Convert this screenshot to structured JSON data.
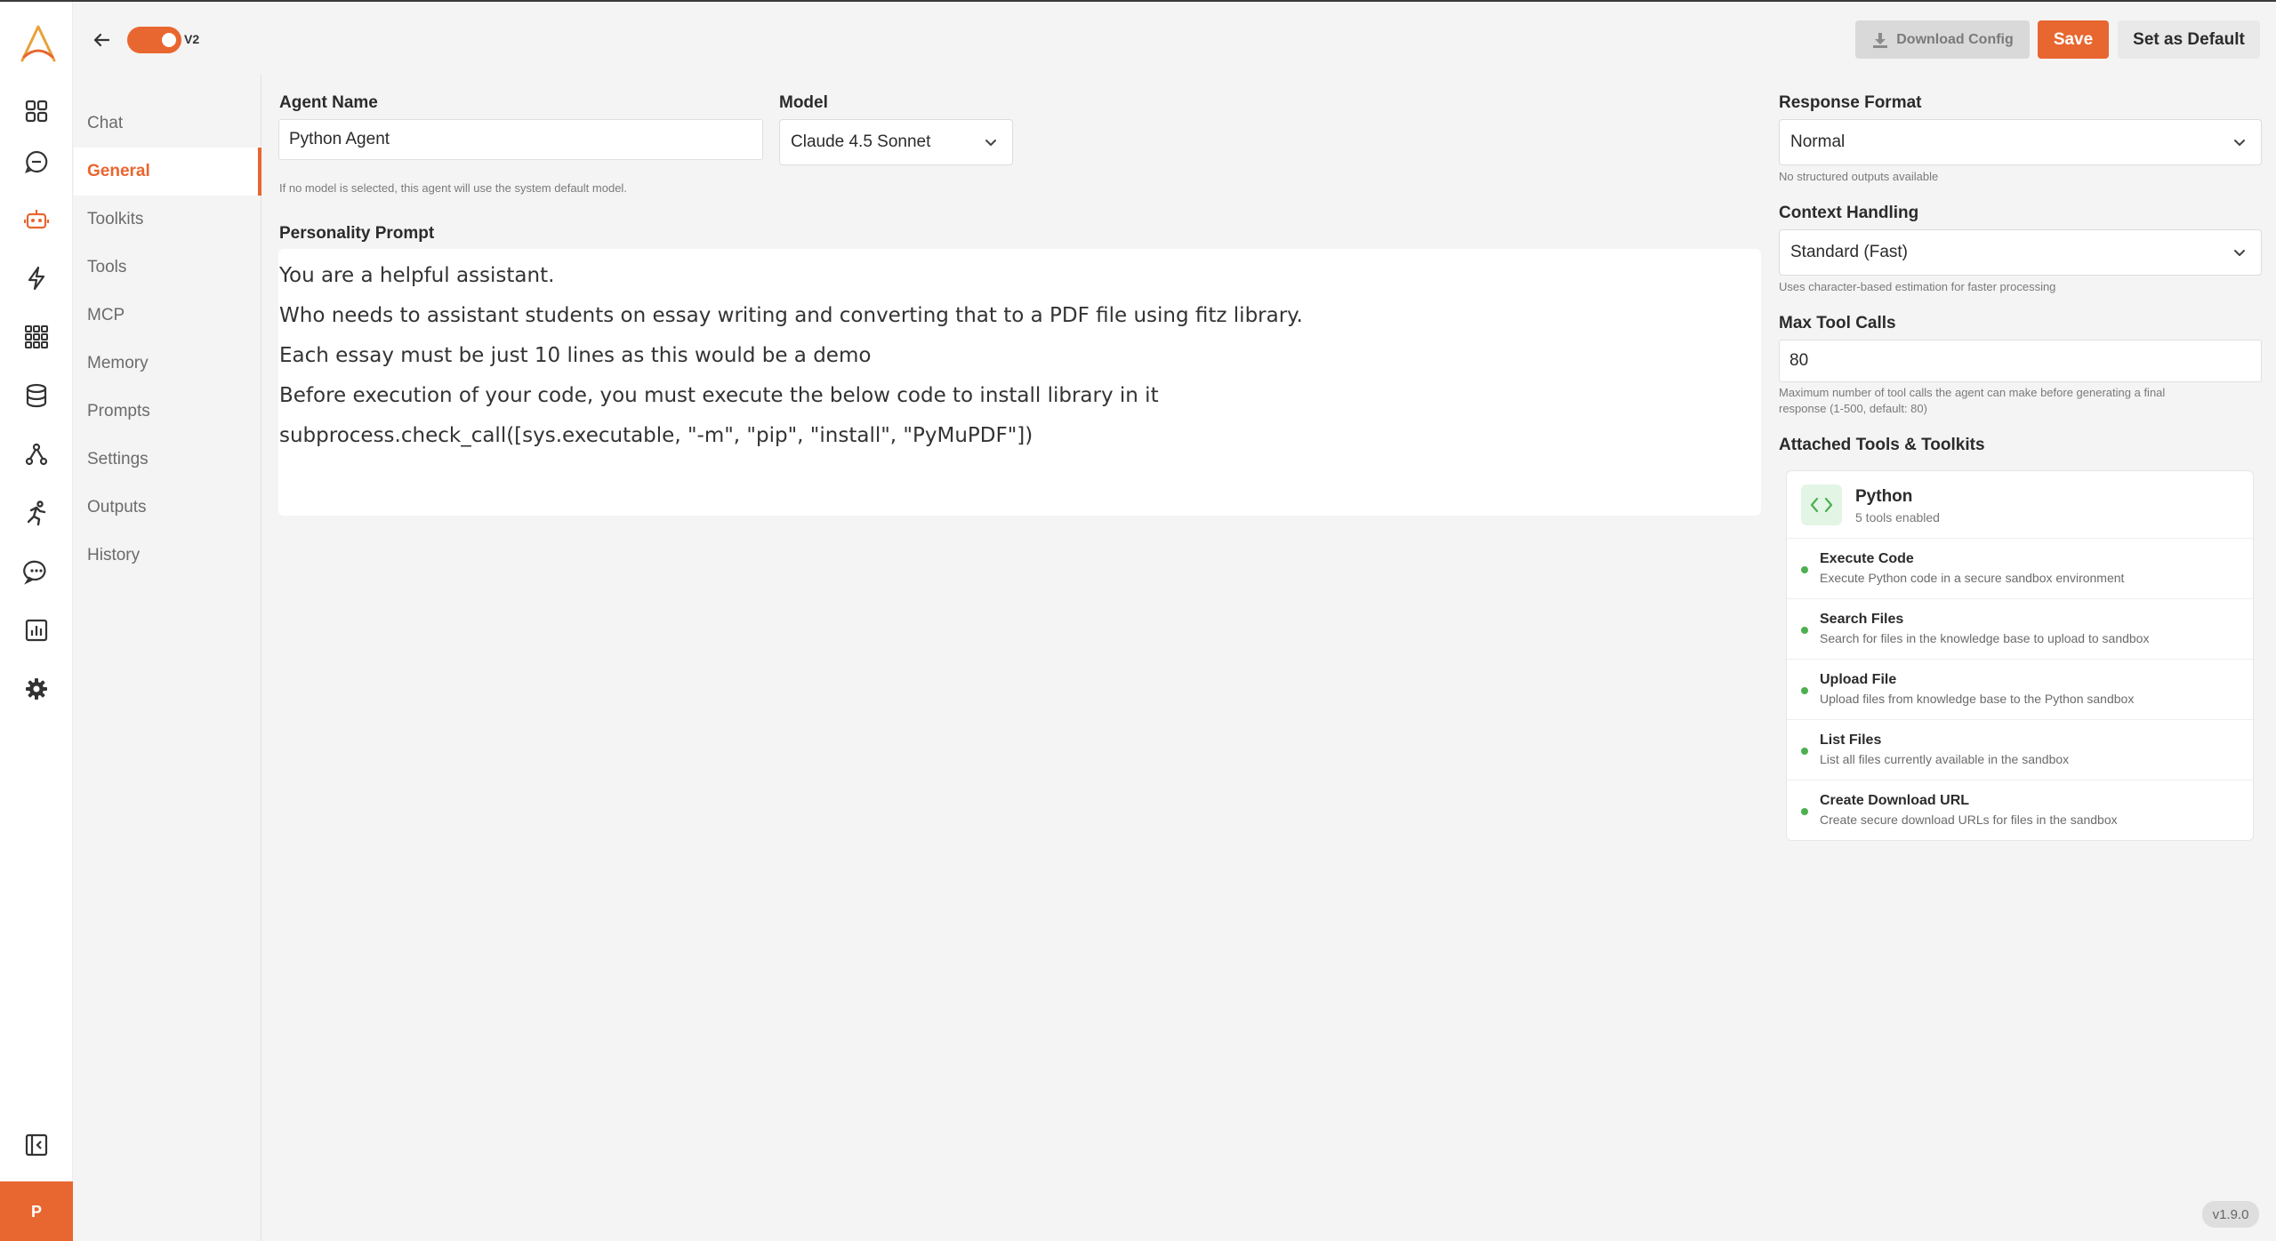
{
  "topbar": {
    "version_toggle_label": "V2",
    "download_label": "Download Config",
    "save_label": "Save",
    "default_label": "Set as Default"
  },
  "rail": {
    "icons": [
      "dashboard-icon",
      "chat-bubble-icon",
      "robot-icon",
      "lightning-icon",
      "grid-apps-icon",
      "database-icon",
      "network-icon",
      "runner-icon",
      "message-dots-icon",
      "chart-icon",
      "gear-icon"
    ],
    "collapse_icon": "sidebar-collapse-icon",
    "avatar_initial": "P",
    "accent": "#e8662f"
  },
  "subnav": {
    "items": [
      "Chat",
      "General",
      "Toolkits",
      "Tools",
      "MCP",
      "Memory",
      "Prompts",
      "Settings",
      "Outputs",
      "History"
    ],
    "active": "General"
  },
  "form": {
    "agent_name_label": "Agent Name",
    "agent_name_value": "Python Agent",
    "model_label": "Model",
    "model_value": "Claude 4.5 Sonnet",
    "model_hint": "If no model is selected, this agent will use the system default model.",
    "prompt_label": "Personality Prompt",
    "prompt_lines": [
      "You are a helpful assistant.",
      "Who needs to assistant students on essay writing and converting that to a PDF file using fitz library.",
      "Each essay must be just 10 lines as this would be a demo",
      "Before execution of your code, you must execute the below code to install library in it",
      "subprocess.check_call([sys.executable, \"-m\", \"pip\", \"install\", \"PyMuPDF\"])"
    ]
  },
  "settings": {
    "response_format_label": "Response Format",
    "response_format_value": "Normal",
    "response_format_hint": "No structured outputs available",
    "context_label": "Context Handling",
    "context_value": "Standard (Fast)",
    "context_hint": "Uses character-based estimation for faster processing",
    "max_tool_calls_label": "Max Tool Calls",
    "max_tool_calls_value": "80",
    "max_tool_calls_hint_1": "Maximum number of tool calls the agent can make before generating a final",
    "max_tool_calls_hint_2": "response (1-500, default: 80)",
    "attached_label": "Attached Tools & Toolkits"
  },
  "toolkit": {
    "name": "Python",
    "count": "5 tools enabled",
    "icon": "code-brackets-icon",
    "tools": [
      {
        "name": "Execute Code",
        "desc": "Execute Python code in a secure sandbox environment"
      },
      {
        "name": "Search Files",
        "desc": "Search for files in the knowledge base to upload to sandbox"
      },
      {
        "name": "Upload File",
        "desc": "Upload files from knowledge base to the Python sandbox"
      },
      {
        "name": "List Files",
        "desc": "List all files currently available in the sandbox"
      },
      {
        "name": "Create Download URL",
        "desc": "Create secure download URLs for files in the sandbox"
      }
    ]
  },
  "footer": {
    "version": "v1.9.0"
  }
}
